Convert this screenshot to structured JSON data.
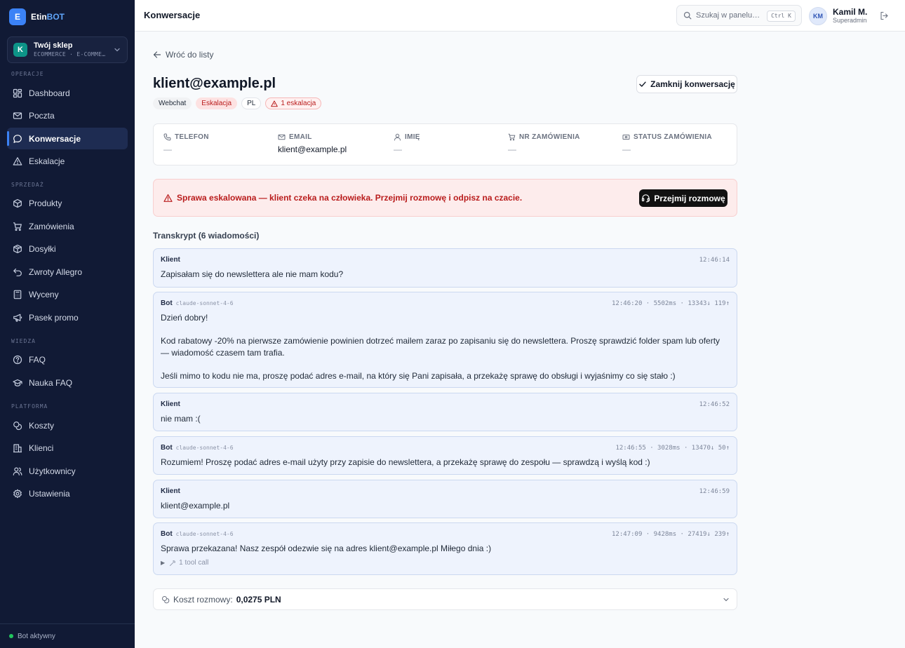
{
  "brand": {
    "logo_letter": "E",
    "name_part1": "Etin",
    "name_part2": "BOT",
    "accent_color": "#60a5fa"
  },
  "store": {
    "avatar_letter": "K",
    "name": "Twój sklep",
    "subtitle": "ECOMMERCE · E-COMME…"
  },
  "nav": {
    "sections": {
      "operations": "OPERACJE",
      "sales": "SPRZEDAŻ",
      "knowledge": "WIEDZA",
      "platform": "PLATFORMA"
    },
    "items": [
      {
        "id": "dashboard",
        "label": "Dashboard",
        "icon": "dashboard-icon"
      },
      {
        "id": "mail",
        "label": "Poczta",
        "icon": "mail-icon"
      },
      {
        "id": "conversations",
        "label": "Konwersacje",
        "icon": "chat-icon",
        "active": true
      },
      {
        "id": "escalations",
        "label": "Eskalacje",
        "icon": "warning-icon"
      },
      {
        "id": "products",
        "label": "Produkty",
        "icon": "box-icon"
      },
      {
        "id": "orders",
        "label": "Zamówienia",
        "icon": "cart-icon"
      },
      {
        "id": "shipments",
        "label": "Dosyłki",
        "icon": "package-icon"
      },
      {
        "id": "returns",
        "label": "Zwroty Allegro",
        "icon": "return-icon"
      },
      {
        "id": "quotes",
        "label": "Wyceny",
        "icon": "calculator-icon"
      },
      {
        "id": "promo",
        "label": "Pasek promo",
        "icon": "megaphone-icon"
      },
      {
        "id": "faq",
        "label": "FAQ",
        "icon": "help-icon"
      },
      {
        "id": "faq-learning",
        "label": "Nauka FAQ",
        "icon": "graduation-icon"
      },
      {
        "id": "costs",
        "label": "Koszty",
        "icon": "coins-icon"
      },
      {
        "id": "clients",
        "label": "Klienci",
        "icon": "building-icon"
      },
      {
        "id": "users",
        "label": "Użytkownicy",
        "icon": "users-icon"
      },
      {
        "id": "settings",
        "label": "Ustawienia",
        "icon": "gear-icon"
      }
    ]
  },
  "sidebar_footer": {
    "status": "Bot aktywny",
    "status_color": "#22c55e"
  },
  "topbar": {
    "title": "Konwersacje",
    "search_placeholder": "Szukaj w panelu…",
    "search_shortcut": "Ctrl K",
    "user": {
      "initials": "KM",
      "name": "Kamil M.",
      "role": "Superadmin"
    }
  },
  "conversation": {
    "back_label": "Wróć do listy",
    "title": "klient@example.pl",
    "close_label": "Zamknij konwersację",
    "tags": {
      "channel": "Webchat",
      "status": "Eskalacja",
      "language": "PL",
      "escalations": "1 eskalacja"
    },
    "info": {
      "phone": {
        "label": "TELEFON",
        "value": "—"
      },
      "email": {
        "label": "EMAIL",
        "value": "klient@example.pl"
      },
      "name": {
        "label": "IMIĘ",
        "value": "—"
      },
      "order_no": {
        "label": "NR ZAMÓWIENIA",
        "value": "—"
      },
      "order_status": {
        "label": "STATUS ZAMÓWIENIA",
        "value": "—"
      }
    },
    "alert": {
      "text": "Sprawa eskalowana — klient czeka na człowieka. Przejmij rozmowę i odpisz na czacie.",
      "button_label": "Przejmij rozmowę"
    },
    "transcript_title": "Transkrypt (6 wiadomości)",
    "messages": [
      {
        "sender": "Klient",
        "time": "12:46:14",
        "text": "Zapisałam się do newslettera ale nie mam kodu?"
      },
      {
        "sender": "Bot",
        "model": "claude-sonnet-4-6",
        "meta": "12:46:20 · 5502ms · 13343↓ 119↑",
        "text": "Dzień dobry!\n\nKod rabatowy -20% na pierwsze zamówienie powinien dotrzeć mailem zaraz po zapisaniu się do newslettera. Proszę sprawdzić folder spam lub oferty — wiadomość czasem tam trafia.\n\nJeśli mimo to kodu nie ma, proszę podać adres e-mail, na który się Pani zapisała, a przekażę sprawę do obsługi i wyjaśnimy co się stało :)"
      },
      {
        "sender": "Klient",
        "time": "12:46:52",
        "text": "nie mam :("
      },
      {
        "sender": "Bot",
        "model": "claude-sonnet-4-6",
        "meta": "12:46:55 · 3028ms · 13470↓ 50↑",
        "text": "Rozumiem! Proszę podać adres e-mail użyty przy zapisie do newslettera, a przekażę sprawę do zespołu — sprawdzą i wyślą kod :)"
      },
      {
        "sender": "Klient",
        "time": "12:46:59",
        "text": "klient@example.pl"
      },
      {
        "sender": "Bot",
        "model": "claude-sonnet-4-6",
        "meta": "12:47:09 · 9428ms · 27419↓ 239↑",
        "text": "Sprawa przekazana! Nasz zespół odezwie się na adres klient@example.pl Miłego dnia :)",
        "tool_calls": "1 tool call"
      }
    ],
    "cost": {
      "label": "Koszt rozmowy:",
      "value": "0,0275 PLN"
    }
  }
}
